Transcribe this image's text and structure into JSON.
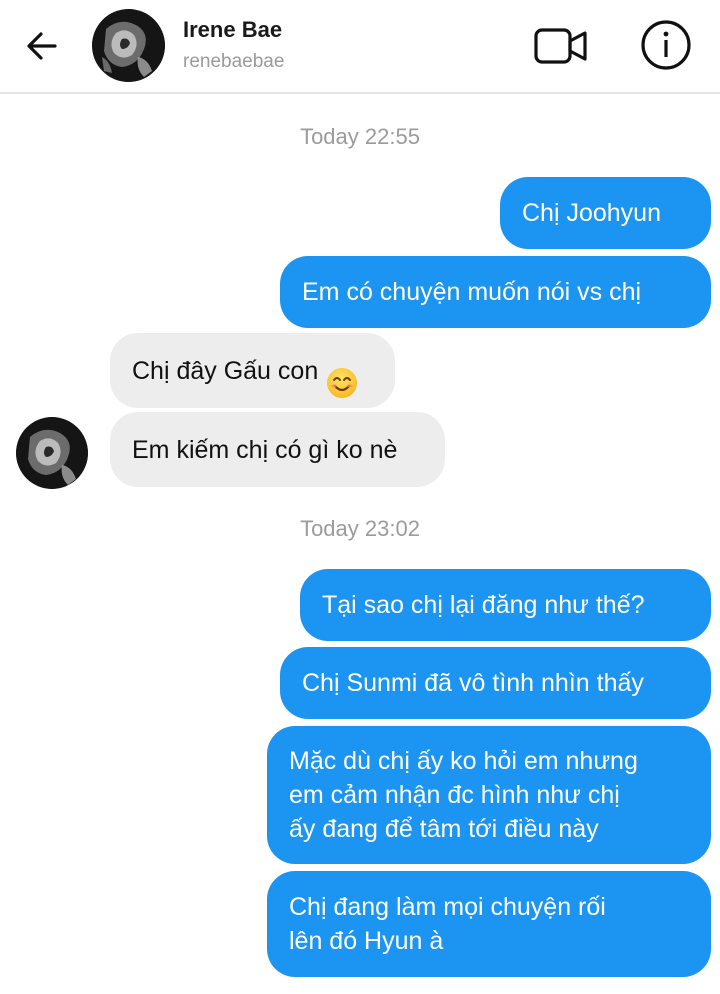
{
  "header": {
    "name": "Irene Bae",
    "username": "renebaebae",
    "back_icon": "arrow-left-icon",
    "video_icon": "video-camera-icon",
    "info_icon": "info-icon"
  },
  "timestamps": {
    "first": "Today 22:55",
    "second": "Today 23:02"
  },
  "messages": [
    {
      "direction": "outgoing",
      "text": "Chị Joohyun"
    },
    {
      "direction": "outgoing",
      "text": "Em có chuyện muốn nói vs chị"
    },
    {
      "direction": "incoming",
      "text": "Chị đây Gấu con",
      "emoji": "smiling-face-emoji"
    },
    {
      "direction": "incoming",
      "text": "Em kiếm chị có gì ko nè"
    },
    {
      "direction": "outgoing",
      "text": "Tại sao chị lại đăng như thế?"
    },
    {
      "direction": "outgoing",
      "text": "Chị Sunmi đã vô tình nhìn thấy"
    },
    {
      "direction": "outgoing",
      "text": "Mặc dù chị ấy ko hỏi em nhưng\nem cảm nhận đc hình như chị\nấy đang để tâm tới điều này"
    },
    {
      "direction": "outgoing",
      "text": "Chị đang làm mọi chuyện rối\nlên đó Hyun à"
    }
  ],
  "colors": {
    "outgoing_bubble": "#1b95f1",
    "incoming_bubble": "#ededed",
    "timestamp_text": "#9b9b9b"
  }
}
